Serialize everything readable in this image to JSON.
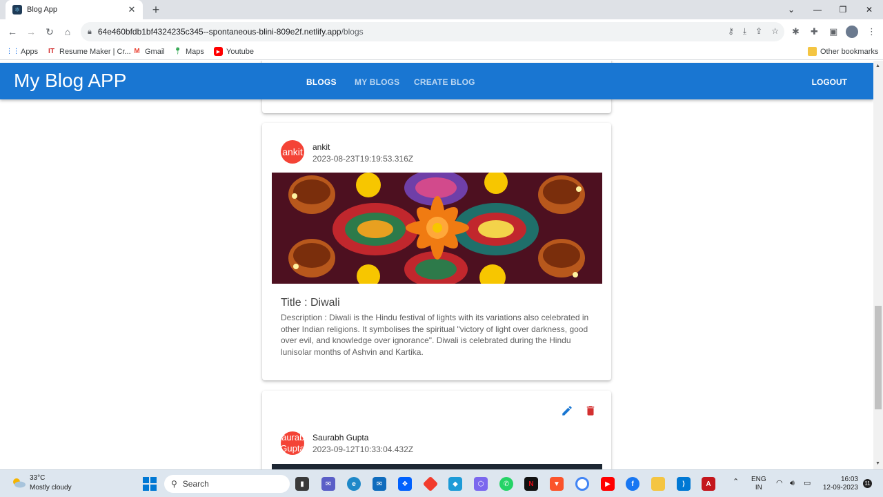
{
  "browser": {
    "tab_title": "Blog App",
    "url_host": "64e460bfdb1bf4324235c345--spontaneous-blini-809e2f.netlify.app",
    "url_path": "/blogs",
    "bookmarks": [
      {
        "label": "Apps"
      },
      {
        "label": "Resume Maker | Cr..."
      },
      {
        "label": "Gmail"
      },
      {
        "label": "Maps"
      },
      {
        "label": "Youtube"
      }
    ],
    "other_bookmarks": "Other bookmarks"
  },
  "app": {
    "brand": "My Blog APP",
    "nav": [
      {
        "label": "BLOGS",
        "active": true
      },
      {
        "label": "MY BLOGS",
        "active": false
      },
      {
        "label": "CREATE BLOG",
        "active": false
      }
    ],
    "logout": "LOGOUT",
    "accent_color": "#1976d2",
    "avatar_color": "#f44336"
  },
  "blogs": [
    {
      "avatar_text": "ankit",
      "author": "ankit",
      "date": "2023-08-23T19:19:53.316Z",
      "title": "Title : Diwali",
      "description": "Description : Diwali is the Hindu festival of lights with its variations also celebrated in other Indian religions. It symbolises the spiritual \"victory of light over darkness, good over evil, and knowledge over ignorance\". Diwali is celebrated during the Hindu lunisolar months of Ashvin and Kartika.",
      "image": "diwali-diyas-rangoli"
    },
    {
      "avatar_text": "Saurabh Gupta",
      "author": "Saurabh Gupta",
      "date": "2023-09-12T10:33:04.432Z",
      "actions": [
        "edit-icon",
        "delete-icon"
      ]
    }
  ],
  "taskbar": {
    "temp": "33°C",
    "weather": "Mostly cloudy",
    "search": "Search",
    "lang_1": "ENG",
    "lang_2": "IN",
    "time": "16:03",
    "date": "12-09-2023",
    "notifications": "11"
  }
}
